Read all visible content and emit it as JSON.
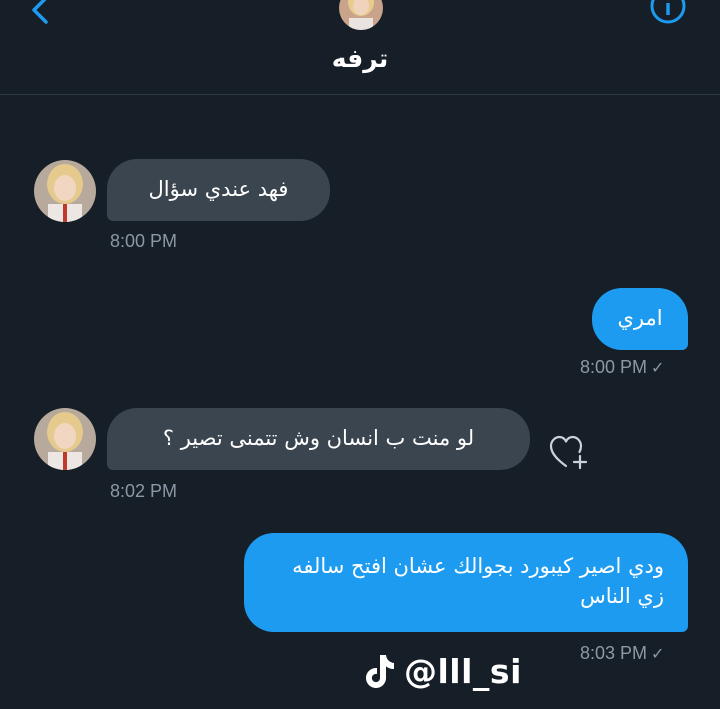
{
  "header": {
    "title": "ترفه",
    "back_icon": "chevron-left-icon",
    "info_icon": "info-icon"
  },
  "colors": {
    "background": "#161e27",
    "incoming_bubble": "#3a4550",
    "outgoing_bubble": "#1d9bf0",
    "timestamp": "#8b98a5"
  },
  "messages": [
    {
      "direction": "incoming",
      "text": "فهد عندي سؤال",
      "time": "8:00 PM"
    },
    {
      "direction": "outgoing",
      "text": "امري",
      "time": "8:00 PM",
      "status": "✓"
    },
    {
      "direction": "incoming",
      "text": "لو منت ب انسان وش تتمنى تصير ؟",
      "time": "8:02 PM"
    },
    {
      "direction": "outgoing",
      "text": "ودي اصير كيبورد بجوالك عشان افتح سالفه زي الناس",
      "time": "8:03 PM",
      "status": "✓"
    }
  ],
  "reaction_icon": "heart-plus-icon",
  "watermark": {
    "icon": "tiktok-icon",
    "handle": "@lll_si"
  }
}
